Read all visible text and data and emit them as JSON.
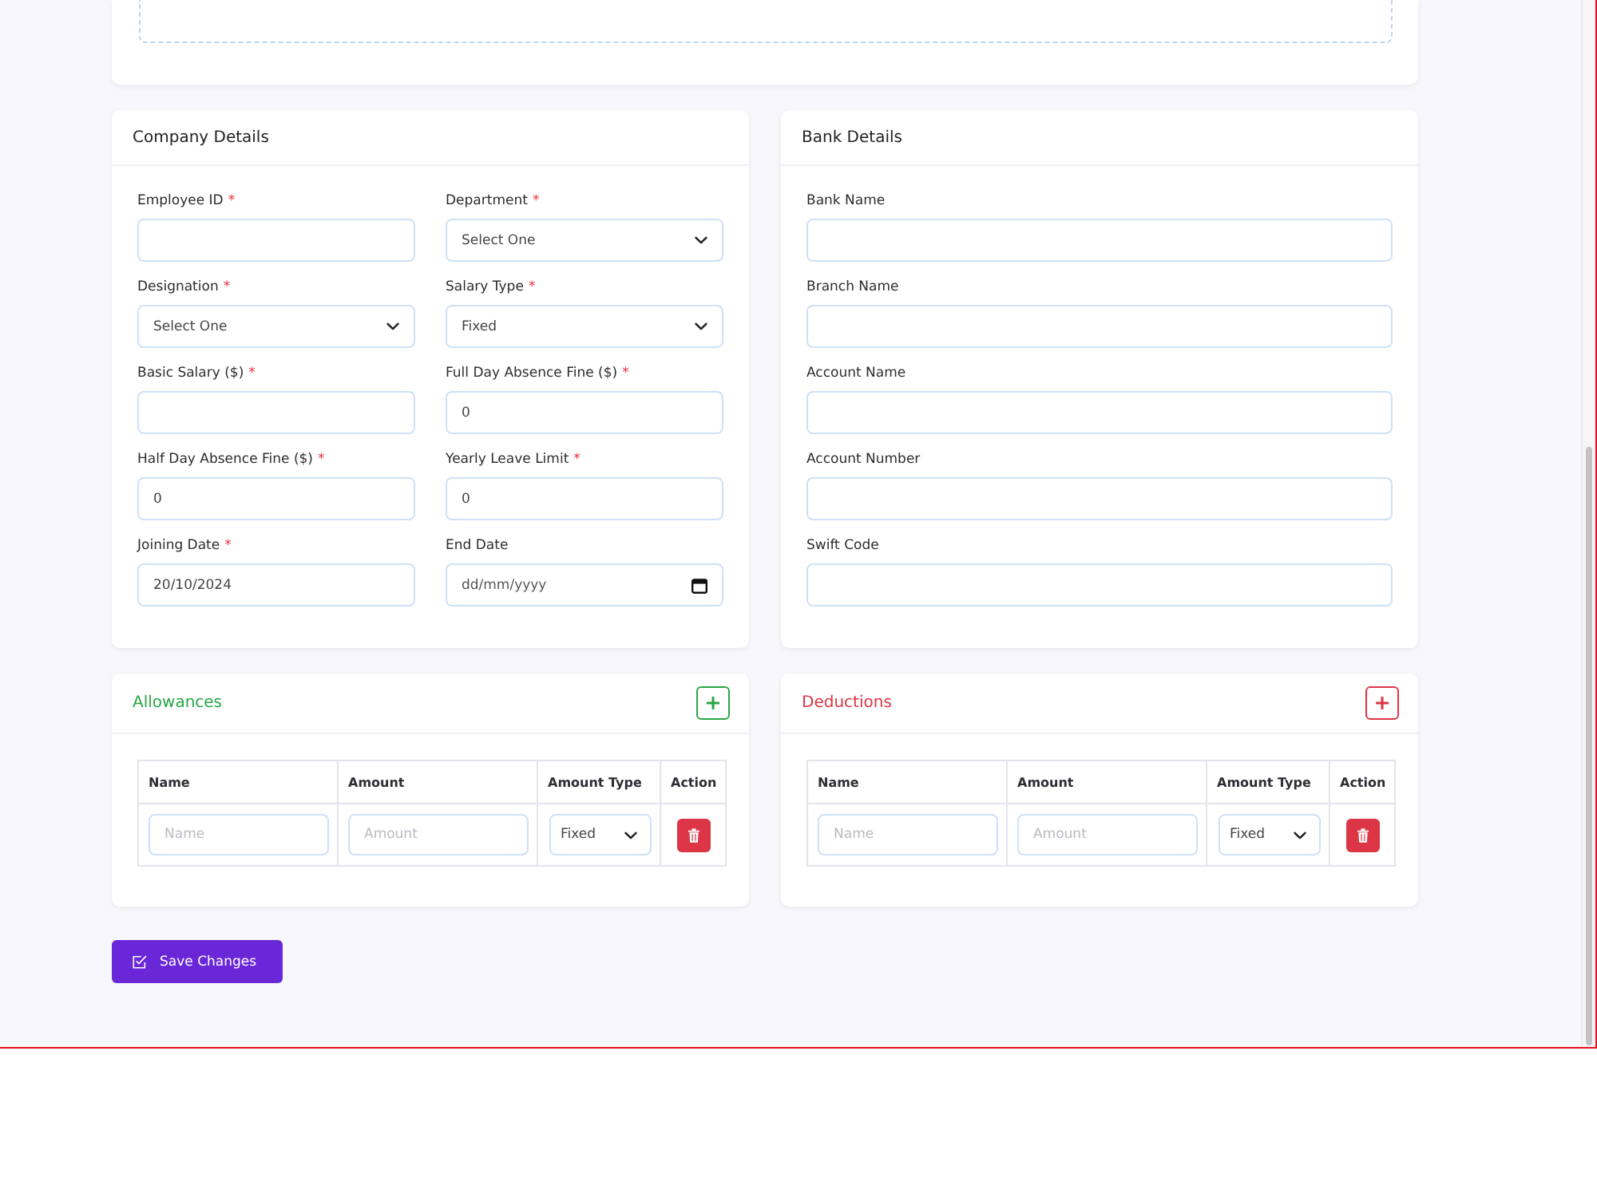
{
  "company_details": {
    "title": "Company Details",
    "fields": [
      {
        "label": "Employee ID",
        "required_mark": "*",
        "kind": "text"
      },
      {
        "label": "Department",
        "required_mark": "*",
        "kind": "select",
        "value": "Select One"
      },
      {
        "label": "Designation",
        "required_mark": "*",
        "kind": "select",
        "value": "Select One"
      },
      {
        "label": "Salary Type",
        "required_mark": "*",
        "kind": "select",
        "value": "Fixed"
      },
      {
        "label": "Basic Salary ($)",
        "required_mark": "*",
        "kind": "text"
      },
      {
        "label": "Full Day Absence Fine ($)",
        "required_mark": "*",
        "kind": "text",
        "value": "0"
      },
      {
        "label": "Half Day Absence Fine ($)",
        "required_mark": "*",
        "kind": "text",
        "value": "0"
      },
      {
        "label": "Yearly Leave Limit",
        "required_mark": "*",
        "kind": "text",
        "value": "0"
      },
      {
        "label": "Joining Date",
        "required_mark": "*",
        "kind": "text",
        "value": "20/10/2024"
      },
      {
        "label": "End Date",
        "kind": "date",
        "placeholder": "dd/mm/yyyy"
      }
    ]
  },
  "bank_details": {
    "title": "Bank Details",
    "fields": [
      {
        "label": "Bank Name",
        "kind": "text"
      },
      {
        "label": "Branch Name",
        "kind": "text"
      },
      {
        "label": "Account Name",
        "kind": "text"
      },
      {
        "label": "Account Number",
        "kind": "text"
      },
      {
        "label": "Swift Code",
        "kind": "text"
      }
    ]
  },
  "adjustments": [
    {
      "title": "Allowances",
      "color": "#28a745",
      "columns": [
        "Name",
        "Amount",
        "Amount Type",
        "Action"
      ],
      "rows": [
        {
          "name_placeholder": "Name",
          "amount_placeholder": "Amount",
          "amount_type": "Fixed"
        }
      ]
    },
    {
      "title": "Deductions",
      "color": "#dc3545",
      "columns": [
        "Name",
        "Amount",
        "Amount Type",
        "Action"
      ],
      "rows": [
        {
          "name_placeholder": "Name",
          "amount_placeholder": "Amount",
          "amount_type": "Fixed"
        }
      ]
    }
  ],
  "save_button": {
    "label": "Save Changes"
  }
}
